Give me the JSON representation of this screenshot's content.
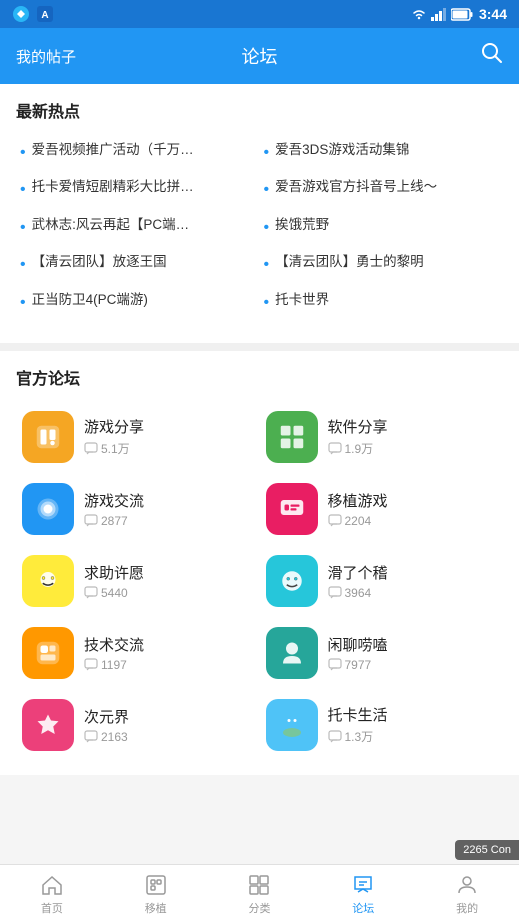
{
  "statusBar": {
    "time": "3:44",
    "icons": [
      "wifi",
      "signal",
      "battery"
    ]
  },
  "header": {
    "left": "我的帖子",
    "title": "论坛",
    "searchIcon": "🔍"
  },
  "hotSection": {
    "title": "最新热点",
    "items": [
      "爱吾视频推广活动（千万…",
      "爱吾3DS游戏活动集锦",
      "托卡爱情短剧精彩大比拼…",
      "爱吾游戏官方抖音号上线～",
      "武林志:风云再起【PC端…",
      "挨饿荒野",
      "【清云团队】放逐王国",
      "【清云团队】勇士的黎明",
      "正当防卫4(PC端游)",
      "托卡世界"
    ]
  },
  "forumSection": {
    "title": "官方论坛",
    "items": [
      {
        "name": "游戏分享",
        "count": "5.1万",
        "bgColor": "#F5A623",
        "emoji": "🕹"
      },
      {
        "name": "软件分享",
        "count": "1.9万",
        "bgColor": "#4CAF50",
        "emoji": "⊞"
      },
      {
        "name": "游戏交流",
        "count": "2877",
        "bgColor": "#2196F3",
        "emoji": "🎮"
      },
      {
        "name": "移植游戏",
        "count": "2204",
        "bgColor": "#E91E63",
        "emoji": "🎮"
      },
      {
        "name": "求助许愿",
        "count": "5440",
        "bgColor": "#FFEB3B",
        "emoji": "😊"
      },
      {
        "name": "滑了个稽",
        "count": "3964",
        "bgColor": "#26C6DA",
        "emoji": "😄"
      },
      {
        "name": "技术交流",
        "count": "1197",
        "bgColor": "#FF9800",
        "emoji": "👾"
      },
      {
        "name": "闲聊唠嗑",
        "count": "7977",
        "bgColor": "#26A69A",
        "emoji": "👤"
      },
      {
        "name": "次元界",
        "count": "2163",
        "bgColor": "#EC407A",
        "emoji": "🦊"
      },
      {
        "name": "托卡生活",
        "count": "1.3万",
        "bgColor": "#4FC3F7",
        "emoji": "🌍"
      }
    ]
  },
  "bottomNav": {
    "items": [
      {
        "label": "首页",
        "icon": "⌂",
        "active": false
      },
      {
        "label": "移植",
        "icon": "⊡",
        "active": false
      },
      {
        "label": "分类",
        "icon": "▦",
        "active": false
      },
      {
        "label": "论坛",
        "icon": "💬",
        "active": true
      },
      {
        "label": "我的",
        "icon": "👤",
        "active": false
      }
    ]
  },
  "watermark": "2265 Con"
}
